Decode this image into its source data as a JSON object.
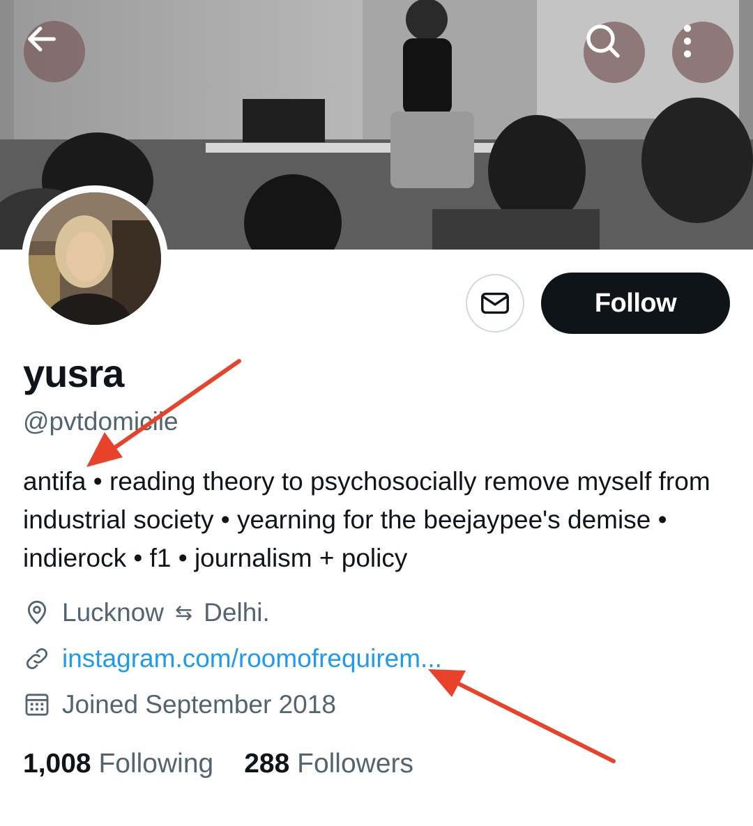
{
  "profile": {
    "display_name": "yusra",
    "handle": "@pvtdomicile",
    "bio": "antifa • reading theory to psychosocially remove myself from industrial society • yearning for the beejaypee's demise • indierock • f1 • journalism + policy",
    "location_from": "Lucknow",
    "location_sep": "⇆",
    "location_to": "Delhi.",
    "website": "instagram.com/roomofrequirem...",
    "joined": "Joined September 2018"
  },
  "stats": {
    "following_count": "1,008",
    "following_label": "Following",
    "followers_count": "288",
    "followers_label": "Followers"
  },
  "actions": {
    "follow_label": "Follow"
  },
  "icons": {
    "back": "arrow-left-icon",
    "search": "search-icon",
    "more": "more-vertical-icon",
    "message": "envelope-icon",
    "location": "map-pin-icon",
    "link": "link-icon",
    "calendar": "calendar-icon"
  },
  "colors": {
    "link": "#1d9bf0",
    "secondary_text": "#536471",
    "primary_text": "#0f1419",
    "annotation": "#e8432a"
  }
}
